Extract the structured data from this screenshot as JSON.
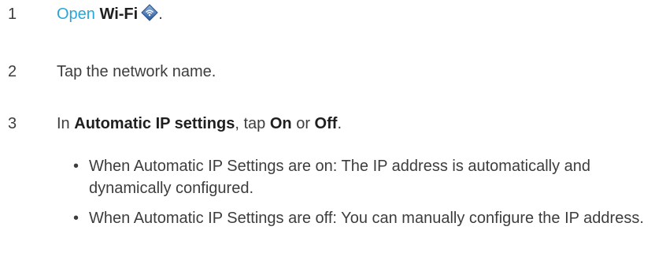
{
  "steps": [
    {
      "number": "1",
      "link_text": "Open",
      "app_name": "Wi-Fi",
      "icon": "wifi-settings-icon",
      "end": "."
    },
    {
      "number": "2",
      "text": "Tap the network name."
    },
    {
      "number": "3",
      "prefix": "In ",
      "setting": "Automatic IP settings",
      "middle": ", tap ",
      "on": "On",
      "or": " or ",
      "off": "Off",
      "end": "."
    }
  ],
  "bullets": [
    "When Automatic IP Settings are on: The IP address is automatically and dynamically configured.",
    "When Automatic IP Settings are off: You can manually configure the IP address."
  ],
  "colors": {
    "link": "#2aa6d6",
    "text": "#3d3d3d",
    "bold": "#1f1f1f"
  }
}
